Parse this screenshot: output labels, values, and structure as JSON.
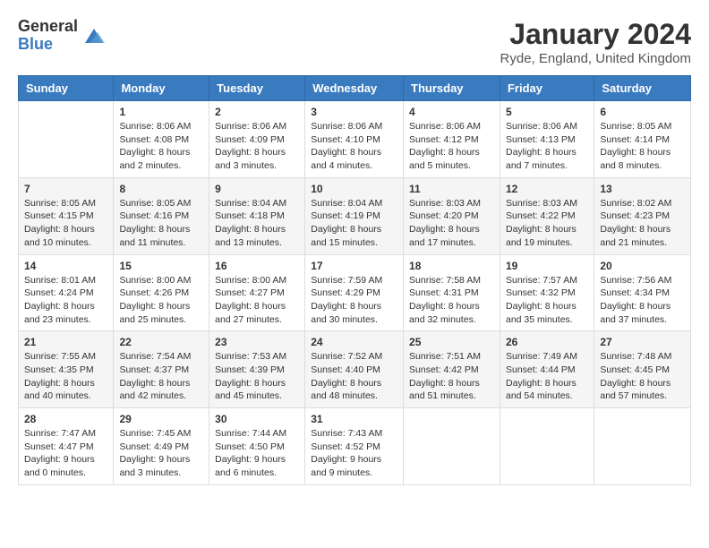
{
  "logo": {
    "general": "General",
    "blue": "Blue"
  },
  "title": "January 2024",
  "location": "Ryde, England, United Kingdom",
  "days_of_week": [
    "Sunday",
    "Monday",
    "Tuesday",
    "Wednesday",
    "Thursday",
    "Friday",
    "Saturday"
  ],
  "weeks": [
    [
      {
        "day": "",
        "info": ""
      },
      {
        "day": "1",
        "info": "Sunrise: 8:06 AM\nSunset: 4:08 PM\nDaylight: 8 hours\nand 2 minutes."
      },
      {
        "day": "2",
        "info": "Sunrise: 8:06 AM\nSunset: 4:09 PM\nDaylight: 8 hours\nand 3 minutes."
      },
      {
        "day": "3",
        "info": "Sunrise: 8:06 AM\nSunset: 4:10 PM\nDaylight: 8 hours\nand 4 minutes."
      },
      {
        "day": "4",
        "info": "Sunrise: 8:06 AM\nSunset: 4:12 PM\nDaylight: 8 hours\nand 5 minutes."
      },
      {
        "day": "5",
        "info": "Sunrise: 8:06 AM\nSunset: 4:13 PM\nDaylight: 8 hours\nand 7 minutes."
      },
      {
        "day": "6",
        "info": "Sunrise: 8:05 AM\nSunset: 4:14 PM\nDaylight: 8 hours\nand 8 minutes."
      }
    ],
    [
      {
        "day": "7",
        "info": "Sunrise: 8:05 AM\nSunset: 4:15 PM\nDaylight: 8 hours\nand 10 minutes."
      },
      {
        "day": "8",
        "info": "Sunrise: 8:05 AM\nSunset: 4:16 PM\nDaylight: 8 hours\nand 11 minutes."
      },
      {
        "day": "9",
        "info": "Sunrise: 8:04 AM\nSunset: 4:18 PM\nDaylight: 8 hours\nand 13 minutes."
      },
      {
        "day": "10",
        "info": "Sunrise: 8:04 AM\nSunset: 4:19 PM\nDaylight: 8 hours\nand 15 minutes."
      },
      {
        "day": "11",
        "info": "Sunrise: 8:03 AM\nSunset: 4:20 PM\nDaylight: 8 hours\nand 17 minutes."
      },
      {
        "day": "12",
        "info": "Sunrise: 8:03 AM\nSunset: 4:22 PM\nDaylight: 8 hours\nand 19 minutes."
      },
      {
        "day": "13",
        "info": "Sunrise: 8:02 AM\nSunset: 4:23 PM\nDaylight: 8 hours\nand 21 minutes."
      }
    ],
    [
      {
        "day": "14",
        "info": "Sunrise: 8:01 AM\nSunset: 4:24 PM\nDaylight: 8 hours\nand 23 minutes."
      },
      {
        "day": "15",
        "info": "Sunrise: 8:00 AM\nSunset: 4:26 PM\nDaylight: 8 hours\nand 25 minutes."
      },
      {
        "day": "16",
        "info": "Sunrise: 8:00 AM\nSunset: 4:27 PM\nDaylight: 8 hours\nand 27 minutes."
      },
      {
        "day": "17",
        "info": "Sunrise: 7:59 AM\nSunset: 4:29 PM\nDaylight: 8 hours\nand 30 minutes."
      },
      {
        "day": "18",
        "info": "Sunrise: 7:58 AM\nSunset: 4:31 PM\nDaylight: 8 hours\nand 32 minutes."
      },
      {
        "day": "19",
        "info": "Sunrise: 7:57 AM\nSunset: 4:32 PM\nDaylight: 8 hours\nand 35 minutes."
      },
      {
        "day": "20",
        "info": "Sunrise: 7:56 AM\nSunset: 4:34 PM\nDaylight: 8 hours\nand 37 minutes."
      }
    ],
    [
      {
        "day": "21",
        "info": "Sunrise: 7:55 AM\nSunset: 4:35 PM\nDaylight: 8 hours\nand 40 minutes."
      },
      {
        "day": "22",
        "info": "Sunrise: 7:54 AM\nSunset: 4:37 PM\nDaylight: 8 hours\nand 42 minutes."
      },
      {
        "day": "23",
        "info": "Sunrise: 7:53 AM\nSunset: 4:39 PM\nDaylight: 8 hours\nand 45 minutes."
      },
      {
        "day": "24",
        "info": "Sunrise: 7:52 AM\nSunset: 4:40 PM\nDaylight: 8 hours\nand 48 minutes."
      },
      {
        "day": "25",
        "info": "Sunrise: 7:51 AM\nSunset: 4:42 PM\nDaylight: 8 hours\nand 51 minutes."
      },
      {
        "day": "26",
        "info": "Sunrise: 7:49 AM\nSunset: 4:44 PM\nDaylight: 8 hours\nand 54 minutes."
      },
      {
        "day": "27",
        "info": "Sunrise: 7:48 AM\nSunset: 4:45 PM\nDaylight: 8 hours\nand 57 minutes."
      }
    ],
    [
      {
        "day": "28",
        "info": "Sunrise: 7:47 AM\nSunset: 4:47 PM\nDaylight: 9 hours\nand 0 minutes."
      },
      {
        "day": "29",
        "info": "Sunrise: 7:45 AM\nSunset: 4:49 PM\nDaylight: 9 hours\nand 3 minutes."
      },
      {
        "day": "30",
        "info": "Sunrise: 7:44 AM\nSunset: 4:50 PM\nDaylight: 9 hours\nand 6 minutes."
      },
      {
        "day": "31",
        "info": "Sunrise: 7:43 AM\nSunset: 4:52 PM\nDaylight: 9 hours\nand 9 minutes."
      },
      {
        "day": "",
        "info": ""
      },
      {
        "day": "",
        "info": ""
      },
      {
        "day": "",
        "info": ""
      }
    ]
  ]
}
